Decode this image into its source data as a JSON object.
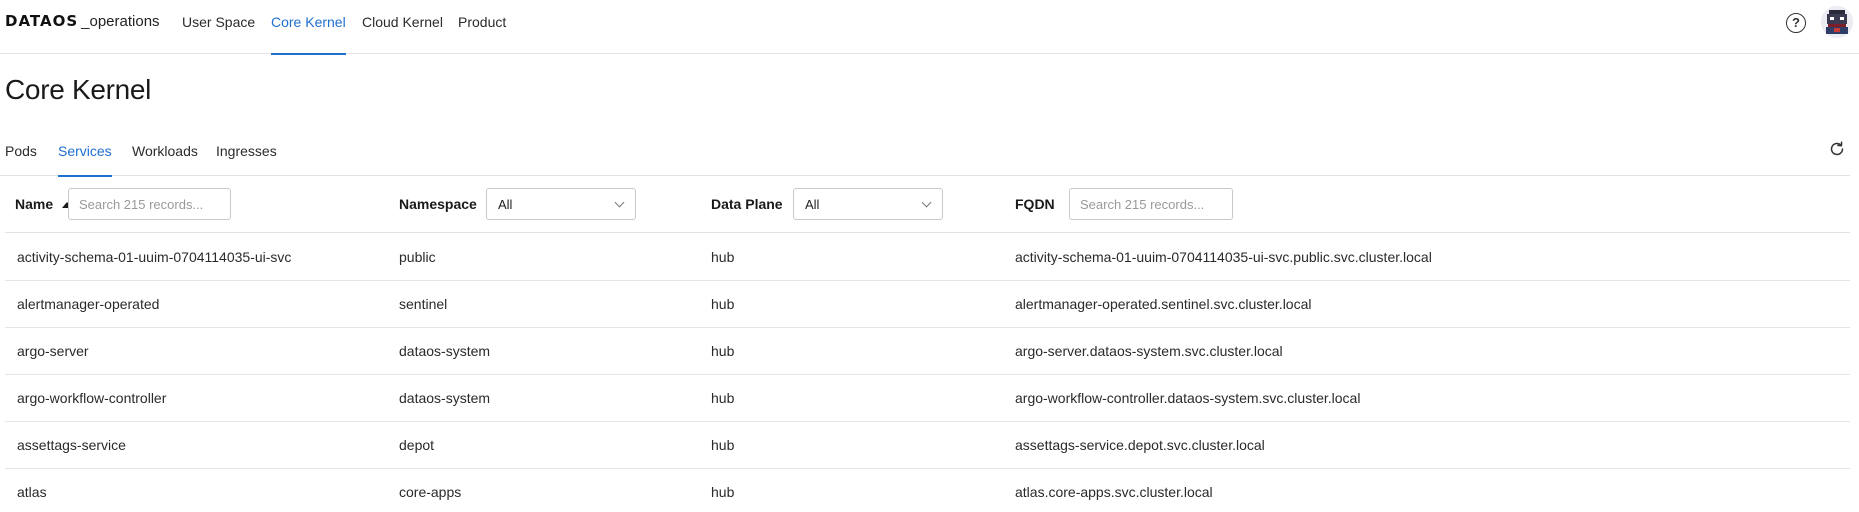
{
  "app": {
    "brand": "DATAOS",
    "suffix": "_operations"
  },
  "nav": {
    "items": [
      {
        "label": "User Space"
      },
      {
        "label": "Core Kernel"
      },
      {
        "label": "Cloud Kernel"
      },
      {
        "label": "Product"
      }
    ],
    "active": "Core Kernel"
  },
  "header_icons": {
    "help": "?",
    "help_icon": "help-circle-icon",
    "avatar_icon": "user-avatar"
  },
  "page": {
    "title": "Core Kernel"
  },
  "tabs": {
    "items": [
      {
        "label": "Pods"
      },
      {
        "label": "Services"
      },
      {
        "label": "Workloads"
      },
      {
        "label": "Ingresses"
      }
    ],
    "active": "Services",
    "refresh_icon": "refresh-icon"
  },
  "table": {
    "columns": [
      {
        "label": "Name",
        "sorted": "ascending",
        "filter": {
          "type": "search",
          "placeholder": "Search 215 records..."
        }
      },
      {
        "label": "Namespace",
        "filter": {
          "type": "select",
          "value": "All"
        }
      },
      {
        "label": "Data Plane",
        "filter": {
          "type": "select",
          "value": "All"
        }
      },
      {
        "label": "FQDN",
        "filter": {
          "type": "search",
          "placeholder": "Search 215 records..."
        }
      }
    ],
    "rows": [
      {
        "name": "activity-schema-01-uuim-0704114035-ui-svc",
        "namespace": "public",
        "plane": "hub",
        "fqdn": "activity-schema-01-uuim-0704114035-ui-svc.public.svc.cluster.local"
      },
      {
        "name": "alertmanager-operated",
        "namespace": "sentinel",
        "plane": "hub",
        "fqdn": "alertmanager-operated.sentinel.svc.cluster.local"
      },
      {
        "name": "argo-server",
        "namespace": "dataos-system",
        "plane": "hub",
        "fqdn": "argo-server.dataos-system.svc.cluster.local"
      },
      {
        "name": "argo-workflow-controller",
        "namespace": "dataos-system",
        "plane": "hub",
        "fqdn": "argo-workflow-controller.dataos-system.svc.cluster.local"
      },
      {
        "name": "assettags-service",
        "namespace": "depot",
        "plane": "hub",
        "fqdn": "assettags-service.depot.svc.cluster.local"
      },
      {
        "name": "atlas",
        "namespace": "core-apps",
        "plane": "hub",
        "fqdn": "atlas.core-apps.svc.cluster.local"
      }
    ]
  },
  "colors": {
    "accent": "#1f6fd1",
    "border": "#e3e3e3",
    "text": "#1f1f1f"
  }
}
